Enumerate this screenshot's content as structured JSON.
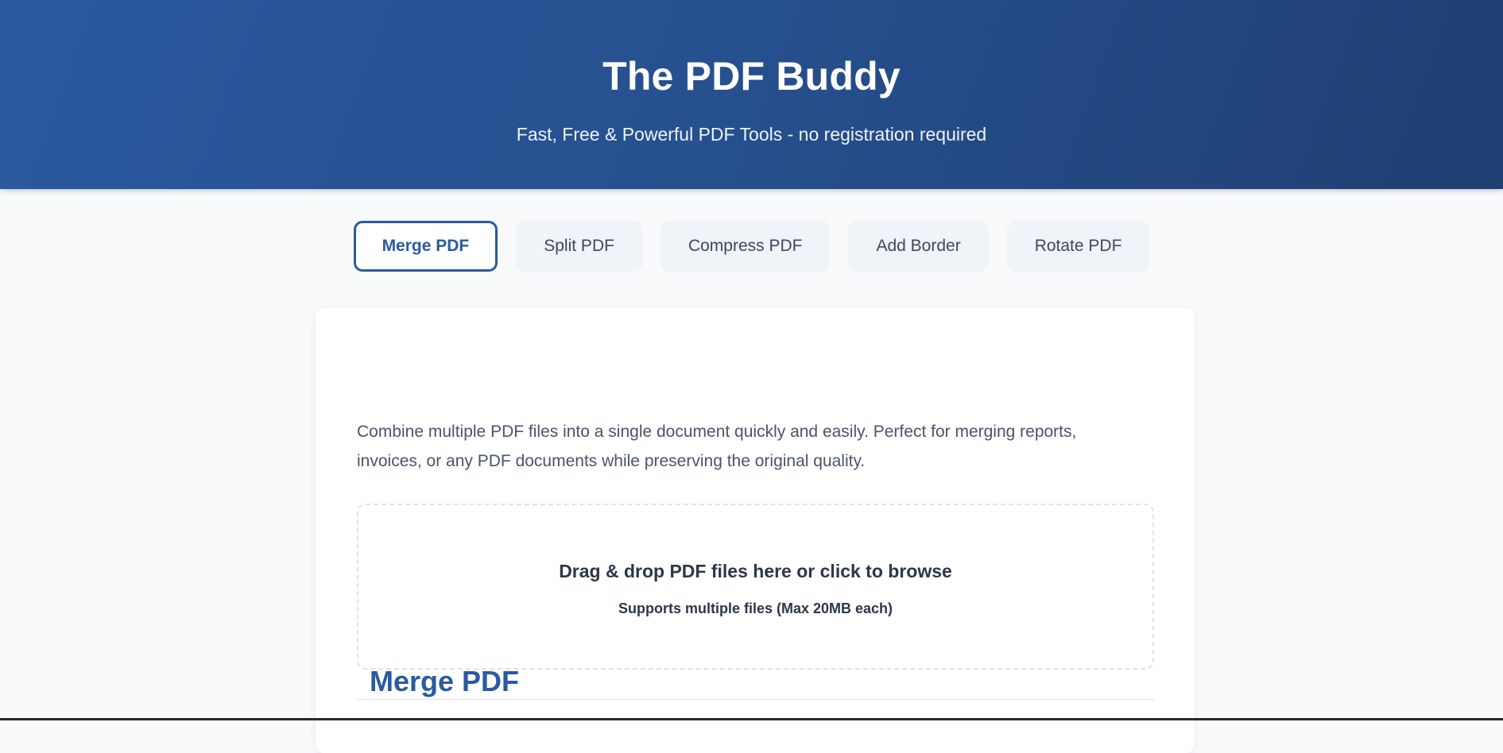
{
  "header": {
    "title": "The PDF Buddy",
    "subtitle": "Fast, Free & Powerful PDF Tools - no registration required"
  },
  "tabs": [
    {
      "label": "Merge PDF",
      "active": true
    },
    {
      "label": "Split PDF",
      "active": false
    },
    {
      "label": "Compress PDF",
      "active": false
    },
    {
      "label": "Add Border",
      "active": false
    },
    {
      "label": "Rotate PDF",
      "active": false
    }
  ],
  "tool": {
    "title": "Merge PDF",
    "description": "Combine multiple PDF files into a single document quickly and easily. Perfect for merging reports, invoices, or any PDF documents while preserving the original quality.",
    "dropzone": {
      "title": "Drag & drop PDF files here or click to browse",
      "subtitle": "Supports multiple files (Max 20MB each)"
    }
  },
  "colors": {
    "brand": "#2b5aa0",
    "header_gradient_start": "#2b5aa0",
    "header_gradient_end": "#203f72",
    "page_background": "#f8fafc"
  }
}
